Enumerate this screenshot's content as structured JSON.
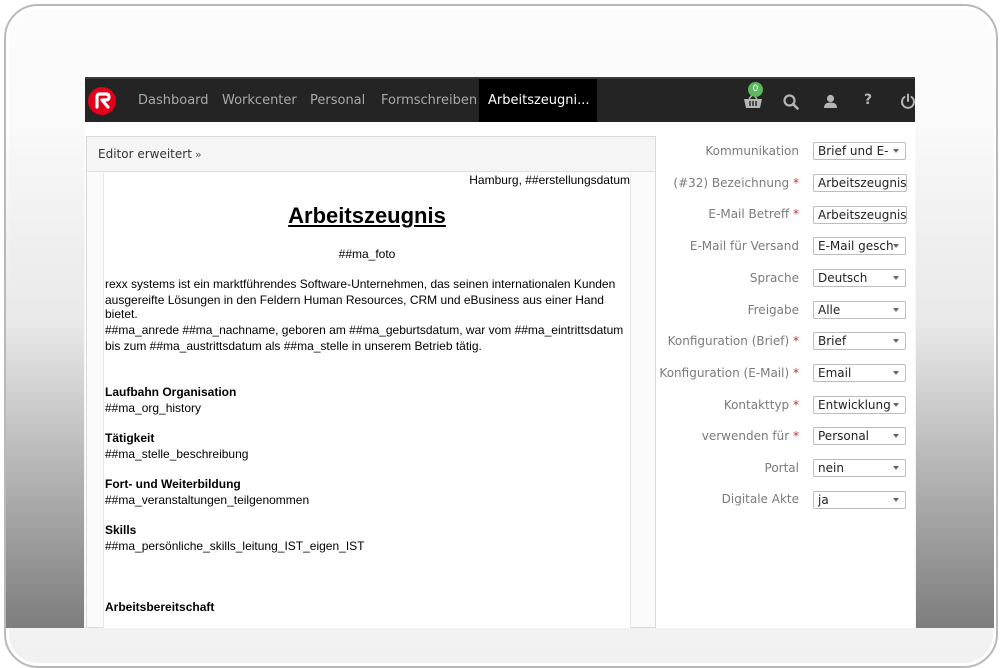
{
  "nav": {
    "items": [
      {
        "label": "Dashboard"
      },
      {
        "label": "Workcenter"
      },
      {
        "label": "Personal"
      },
      {
        "label": "Formschreiben"
      }
    ],
    "active": "Arbeitszeugni...",
    "cart_count": "0"
  },
  "editor": {
    "header": "Editor erweitert",
    "header_icon": "double-chevron-down-icon",
    "doc": {
      "place_date": "Hamburg, ##erstellungsdatum",
      "title": "Arbeitszeugnis",
      "photo": "##ma_foto",
      "intro_line1": "rexx systems ist ein marktführendes Software-Unternehmen, das seinen internationalen Kunden",
      "intro_line2": "ausgereifte Lösungen in den Feldern Human Resources, CRM und eBusiness aus einer Hand bietet.",
      "person_line1": "##ma_anrede ##ma_nachname, geboren am ##ma_geburtsdatum, war vom ##ma_eintrittsdatum",
      "person_line2": "bis zum ##ma_austrittsdatum als ##ma_stelle in unserem Betrieb tätig.",
      "sections": [
        {
          "heading": "Laufbahn Organisation",
          "value": "##ma_org_history"
        },
        {
          "heading": "Tätigkeit",
          "value": "##ma_stelle_beschreibung"
        },
        {
          "heading": "Fort- und Weiterbildung",
          "value": "##ma_veranstaltungen_teilgenommen"
        },
        {
          "heading": "Skills",
          "value": "##ma_persönliche_skills_leitung_IST_eigen_IST"
        }
      ],
      "last_heading": "Arbeitsbereitschaft"
    }
  },
  "form": {
    "fields": [
      {
        "label": "Kommunikation",
        "required": false,
        "value": "Brief und E-",
        "type": "select"
      },
      {
        "label": "(#32) Bezeichnung",
        "required": true,
        "value": "Arbeitszeugnis (",
        "type": "text"
      },
      {
        "label": "E-Mail Betreff",
        "required": true,
        "value": "Arbeitszeugnis",
        "type": "text"
      },
      {
        "label": "E-Mail für Versand",
        "required": false,
        "value": "E-Mail gesch",
        "type": "select"
      },
      {
        "label": "Sprache",
        "required": false,
        "value": "Deutsch",
        "type": "select"
      },
      {
        "label": "Freigabe",
        "required": false,
        "value": "Alle",
        "type": "select"
      },
      {
        "label": "Konfiguration (Brief)",
        "required": true,
        "value": "Brief",
        "type": "select"
      },
      {
        "label": "Konfiguration (E-Mail)",
        "required": true,
        "value": "Email",
        "type": "select"
      },
      {
        "label": "Kontakttyp",
        "required": true,
        "value": "Entwicklung",
        "type": "select"
      },
      {
        "label": "verwenden für",
        "required": true,
        "value": "Personal",
        "type": "select"
      },
      {
        "label": "Portal",
        "required": false,
        "value": "nein",
        "type": "select"
      },
      {
        "label": "Digitale Akte",
        "required": false,
        "value": "ja",
        "type": "select"
      }
    ],
    "required_marker": "*"
  }
}
